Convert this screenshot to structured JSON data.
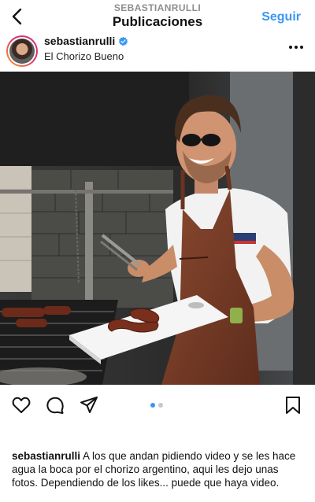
{
  "header": {
    "subtitle": "SEBASTIANRULLI",
    "title": "Publicaciones",
    "follow_label": "Seguir"
  },
  "post": {
    "username": "sebastianrulli",
    "verified": true,
    "location": "El Chorizo Bueno",
    "carousel": {
      "total": 2,
      "current": 1
    },
    "caption": {
      "username": "sebastianrulli",
      "text": "A los que andan pidiendo video y se les hace agua la boca por el chorizo argentino, aqui les dejo unas fotos. Dependiendo de los likes... puede que haya video."
    }
  },
  "colors": {
    "accent": "#3897f0",
    "text": "#111111",
    "muted": "#8e8e8e",
    "apron": "#7a3b26"
  },
  "icons": [
    "back-chevron-icon",
    "verified-badge-icon",
    "more-options-icon",
    "heart-icon",
    "comment-icon",
    "share-icon",
    "bookmark-icon"
  ]
}
